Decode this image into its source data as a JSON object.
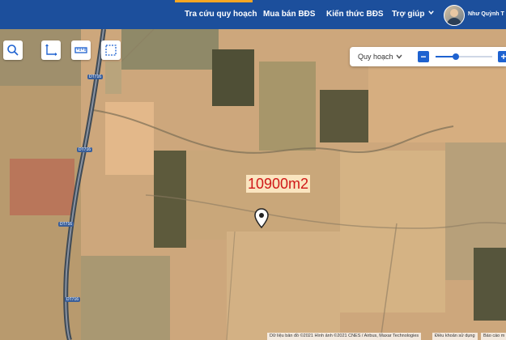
{
  "nav": {
    "items": [
      {
        "label": "Tra cứu quy hoạch",
        "active": true
      },
      {
        "label": "Mua bán BĐS"
      },
      {
        "label": "Kiến thức BĐS"
      },
      {
        "label": "Trợ giúp",
        "has_dropdown": true
      }
    ],
    "user_name": "Như Quỳnh T",
    "accent": "#f5a623",
    "bar_color": "#1c4f9c"
  },
  "toolbar": {
    "tools": [
      "search-icon",
      "axis-measure-icon",
      "ruler-icon",
      "select-area-icon"
    ]
  },
  "layer": {
    "selected": "Quy hoạch",
    "zoom_minus": "−",
    "zoom_plus": "+",
    "zoom_level": 0.35
  },
  "map": {
    "area_label": "10900m2",
    "road_labels": [
      "DT716",
      "DT716",
      "DT716",
      "DT716"
    ]
  },
  "attribution": {
    "text": "Dữ liệu bản đồ ©2021 Hình ảnh ©2021 CNES / Airbus, Maxar Technologies",
    "terms": "Điều khoản sử dụng",
    "report": "Báo cáo m"
  }
}
